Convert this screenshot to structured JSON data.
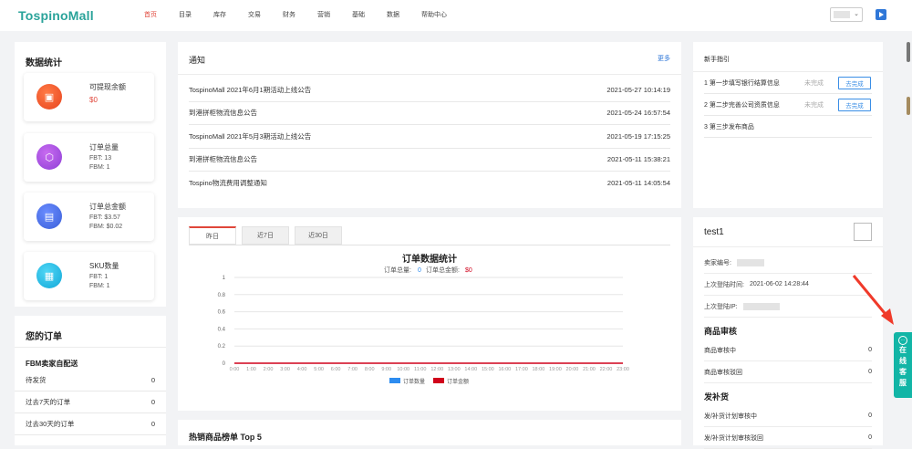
{
  "app": {
    "logo": "TospinoMall"
  },
  "nav": [
    "首页",
    "目录",
    "库存",
    "交易",
    "财务",
    "营销",
    "基础",
    "数据",
    "帮助中心"
  ],
  "stats": {
    "title": "数据统计",
    "withdrawable": {
      "label": "可提现余额",
      "value": "$0"
    },
    "orders": {
      "label": "订单总量",
      "fbt": "FBT:   13",
      "fbm": "FBM:  1"
    },
    "amount": {
      "label": "订单总金额",
      "fbt": "FBT:   $3.57",
      "fbm": "FBM:  $0.02"
    },
    "sku": {
      "label": "SKU数量",
      "fbt": "FBT:   1",
      "fbm": "FBM:  1"
    }
  },
  "your_orders": {
    "title": "您的订单",
    "subtitle": "FBM卖家自配送",
    "rows": [
      {
        "label": "待发货",
        "value": "0"
      },
      {
        "label": "过去7天的订单",
        "value": "0"
      },
      {
        "label": "过去30天的订单",
        "value": "0"
      }
    ]
  },
  "notice": {
    "title": "通知",
    "more": "更多",
    "items": [
      {
        "title": "TospinoMall 2021年6月1期活动上线公告",
        "time": "2021-05-27 10:14:19"
      },
      {
        "title": "到港拼柜物流信息公告",
        "time": "2021-05-24 16:57:54"
      },
      {
        "title": "TospinoMall 2021年5月3期活动上线公告",
        "time": "2021-05-19 17:15:25"
      },
      {
        "title": "到港拼柜物流信息公告",
        "time": "2021-05-11 15:38:21"
      },
      {
        "title": "Tospino物流费用调整通知",
        "time": "2021-05-11 14:05:54"
      }
    ]
  },
  "order_chart": {
    "tabs": [
      "昨日",
      "近7日",
      "近30日"
    ],
    "active_tab": 0
  },
  "chart_data": {
    "type": "line",
    "title": "订单数据统计",
    "subtitle_count_label": "订单总量:",
    "subtitle_count_value": "0",
    "subtitle_amount_label": "订单总金额:",
    "subtitle_amount_value": "$0",
    "x": [
      "0:00",
      "1:00",
      "2:00",
      "3:00",
      "4:00",
      "5:00",
      "6:00",
      "7:00",
      "8:00",
      "9:00",
      "10:00",
      "11:00",
      "12:00",
      "13:00",
      "14:00",
      "15:00",
      "16:00",
      "17:00",
      "18:00",
      "19:00",
      "20:00",
      "21:00",
      "22:00",
      "23:00"
    ],
    "series": [
      {
        "name": "订单数量",
        "color": "#2d8cf0",
        "values": [
          0,
          0,
          0,
          0,
          0,
          0,
          0,
          0,
          0,
          0,
          0,
          0,
          0,
          0,
          0,
          0,
          0,
          0,
          0,
          0,
          0,
          0,
          0,
          0
        ]
      },
      {
        "name": "订单金额",
        "color": "#d0021b",
        "values": [
          0,
          0,
          0,
          0,
          0,
          0,
          0,
          0,
          0,
          0,
          0,
          0,
          0,
          0,
          0,
          0,
          0,
          0,
          0,
          0,
          0,
          0,
          0,
          0
        ]
      }
    ],
    "yticks": [
      "0",
      "0.2",
      "0.4",
      "0.6",
      "0.8",
      "1"
    ],
    "ylim": [
      0,
      1
    ],
    "grid": true,
    "legend": "bottom"
  },
  "hot_products": {
    "title": "热销商品榜单 Top 5"
  },
  "guide": {
    "title": "新手指引",
    "steps": [
      {
        "label": "1 第一步填写银行结算信息",
        "status": "未完成",
        "button": "去完成"
      },
      {
        "label": "2 第二步完善公司资质信息",
        "status": "未完成",
        "button": "去完成"
      },
      {
        "label": "3 第三步发布商品",
        "status": "",
        "button": ""
      }
    ]
  },
  "account": {
    "name": "test1",
    "seller_id_label": "卖家编号:",
    "last_login_time_label": "上次登陆时间:",
    "last_login_time": "2021-06-02 14:28:44",
    "last_login_ip_label": "上次登陆IP:",
    "goods_review": {
      "title": "商品审核",
      "rows": [
        {
          "label": "商品审核中",
          "value": "0"
        },
        {
          "label": "商品审核驳回",
          "value": "0"
        }
      ]
    },
    "restock": {
      "title": "发补货",
      "rows": [
        {
          "label": "发/补货计划审核中",
          "value": "0"
        },
        {
          "label": "发/补货计划审核驳回",
          "value": "0"
        }
      ]
    }
  },
  "online_service": {
    "chars": [
      "在",
      "线",
      "客",
      "服"
    ]
  }
}
